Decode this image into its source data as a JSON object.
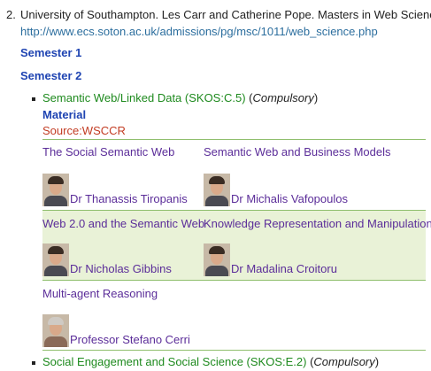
{
  "item_number": "2.",
  "heading": "University of Southampton. Les Carr and Catherine Pope. Masters in Web Science",
  "url": "http://www.ecs.soton.ac.uk/admissions/pg/msc/1011/web_science.php",
  "semester1": "Semester 1",
  "semester2": "Semester 2",
  "course1": {
    "title": "Semantic Web/Linked Data (SKOS:C.5)",
    "open_paren": " (",
    "status": "Compulsory",
    "close_paren": ")",
    "material_label": "Material",
    "source": "Source:WSCCR"
  },
  "topics": [
    {
      "title": "The Social Semantic Web",
      "person": "Dr Thanassis Tiropanis"
    },
    {
      "title": "Semantic Web and Business Models",
      "person": "Dr Michalis Vafopoulos"
    },
    {
      "title": "Web 2.0 and the Semantic Web",
      "person": "Dr Nicholas Gibbins"
    },
    {
      "title": "Knowledge Representation and Manipulation",
      "person": "Dr Madalina Croitoru"
    },
    {
      "title": "Multi-agent Reasoning",
      "person": "Professor Stefano Cerri"
    }
  ],
  "course2": {
    "title": "Social Engagement and Social Science (SKOS:E.2)",
    "open_paren": " (",
    "status": "Compulsory",
    "close_paren": ")"
  }
}
